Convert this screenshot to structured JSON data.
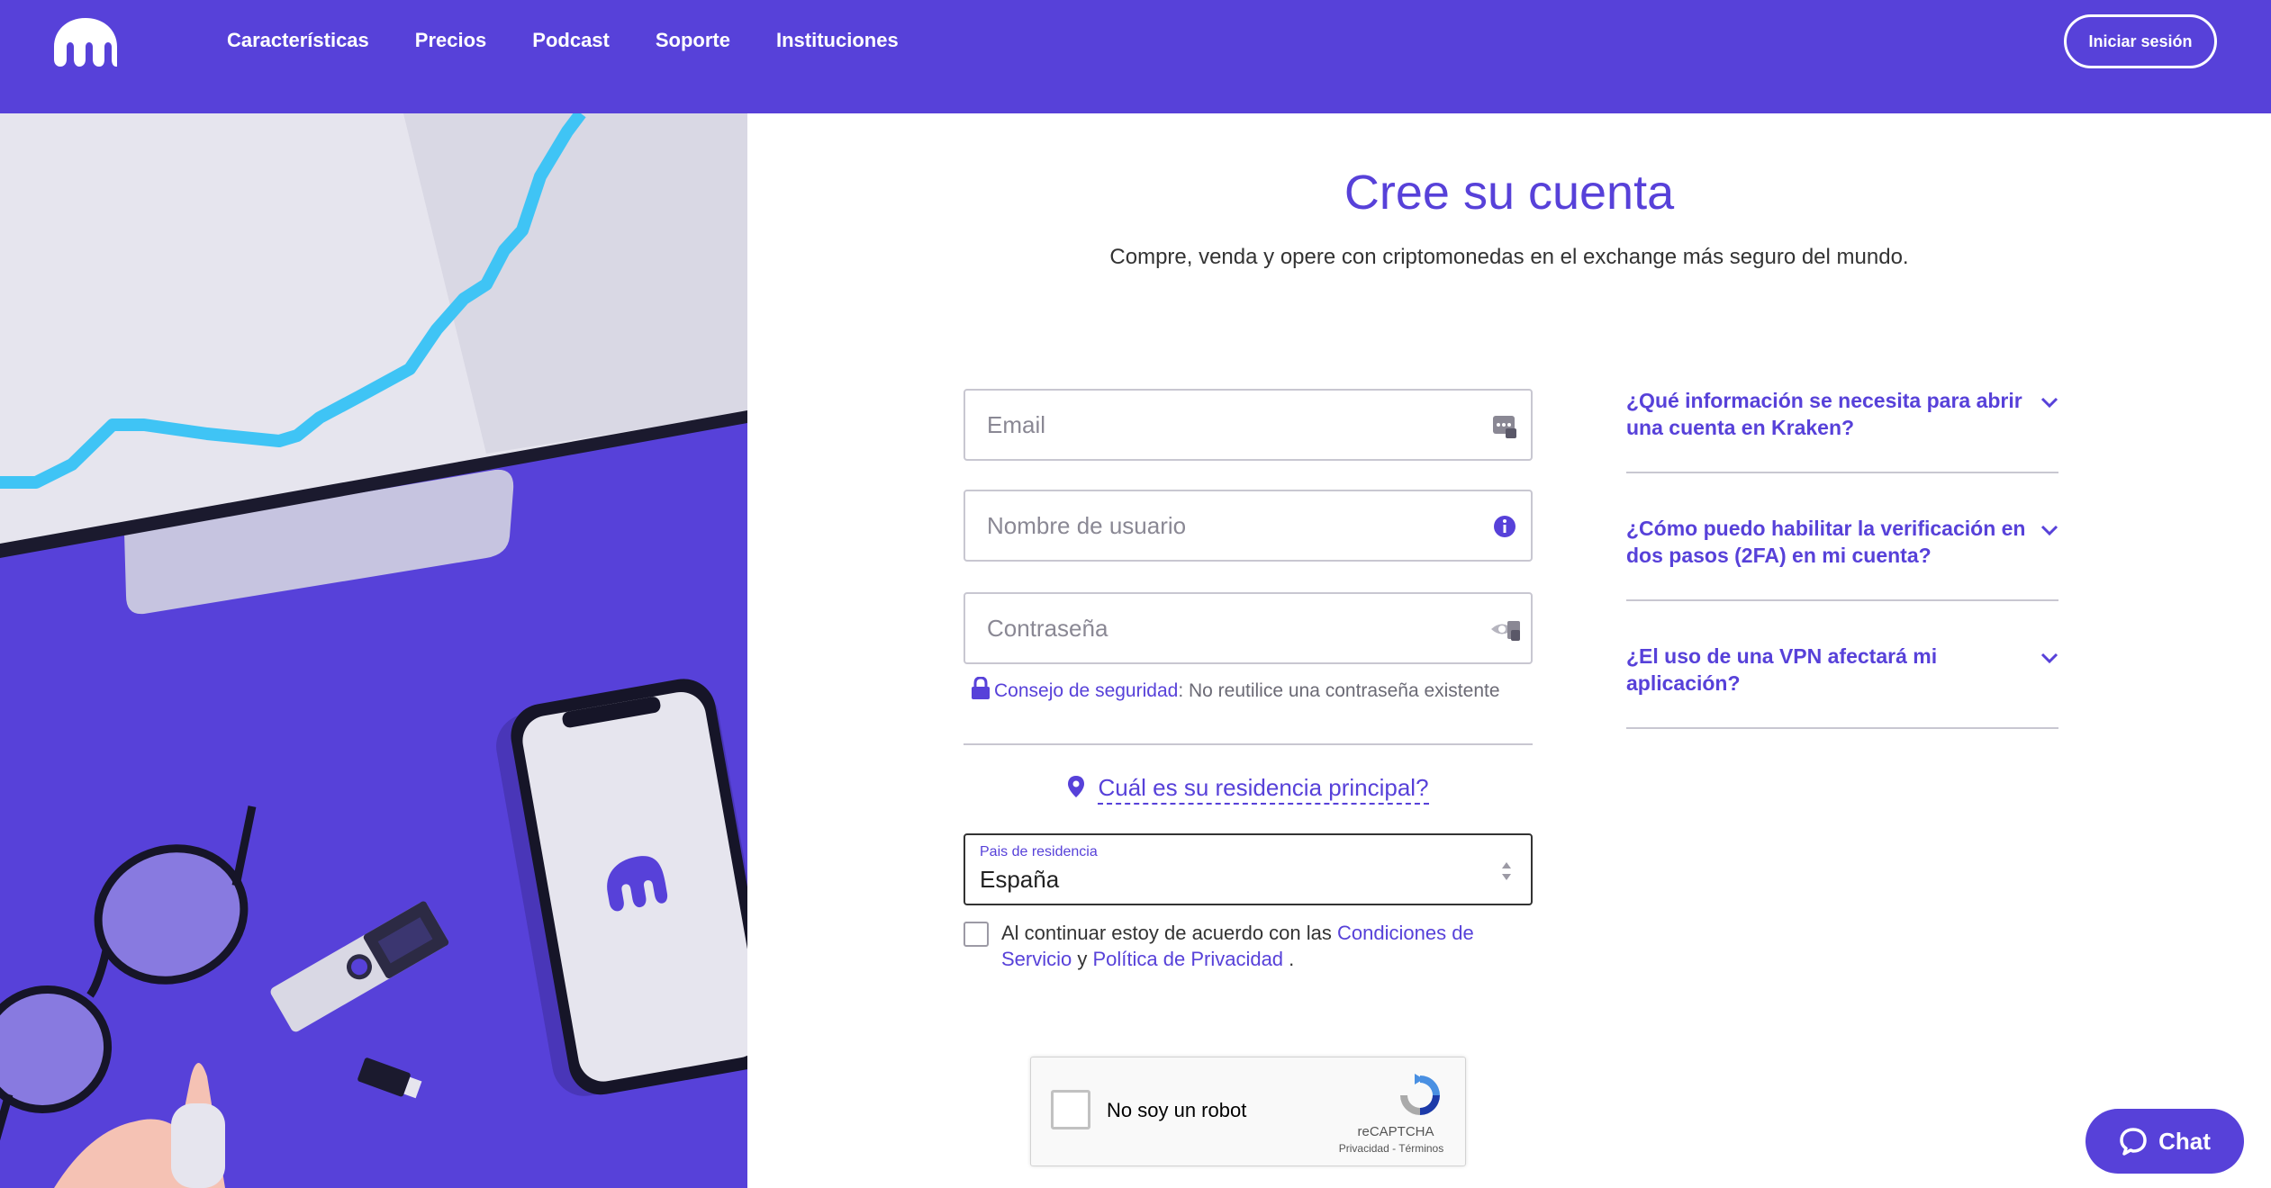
{
  "header": {
    "nav": [
      "Características",
      "Precios",
      "Podcast",
      "Soporte",
      "Instituciones"
    ],
    "login_label": "Iniciar sesión"
  },
  "form": {
    "title": "Cree su cuenta",
    "subtitle": "Compre, venda y opere con criptomonedas en el exchange más seguro del mundo.",
    "email_placeholder": "Email",
    "username_placeholder": "Nombre de usuario",
    "password_placeholder": "Contraseña",
    "tip_link": "Consejo de seguridad",
    "tip_text": ": No reutilice una contraseña existente",
    "residence_question": "Cuál es su residencia principal?",
    "country_label": "Pais de residencia",
    "country_value": "España",
    "agree_text": "Al continuar estoy de acuerdo con las ",
    "terms_link": "Condiciones de Servicio",
    "agree_and": " y ",
    "privacy_link": "Política de Privacidad",
    "agree_end": " ."
  },
  "recaptcha": {
    "label": "No soy un robot",
    "brand": "reCAPTCHA",
    "links": "Privacidad - Términos"
  },
  "faq": [
    "¿Qué información se necesita para abrir una cuenta en Kraken?",
    "¿Cómo puedo habilitar la verificación en dos pasos (2FA) en mi cuenta?",
    "¿El uso de una VPN afectará mi aplicación?"
  ],
  "chat_label": "Chat",
  "colors": {
    "brand": "#5741d9",
    "chart_line": "#3fc4f5"
  }
}
